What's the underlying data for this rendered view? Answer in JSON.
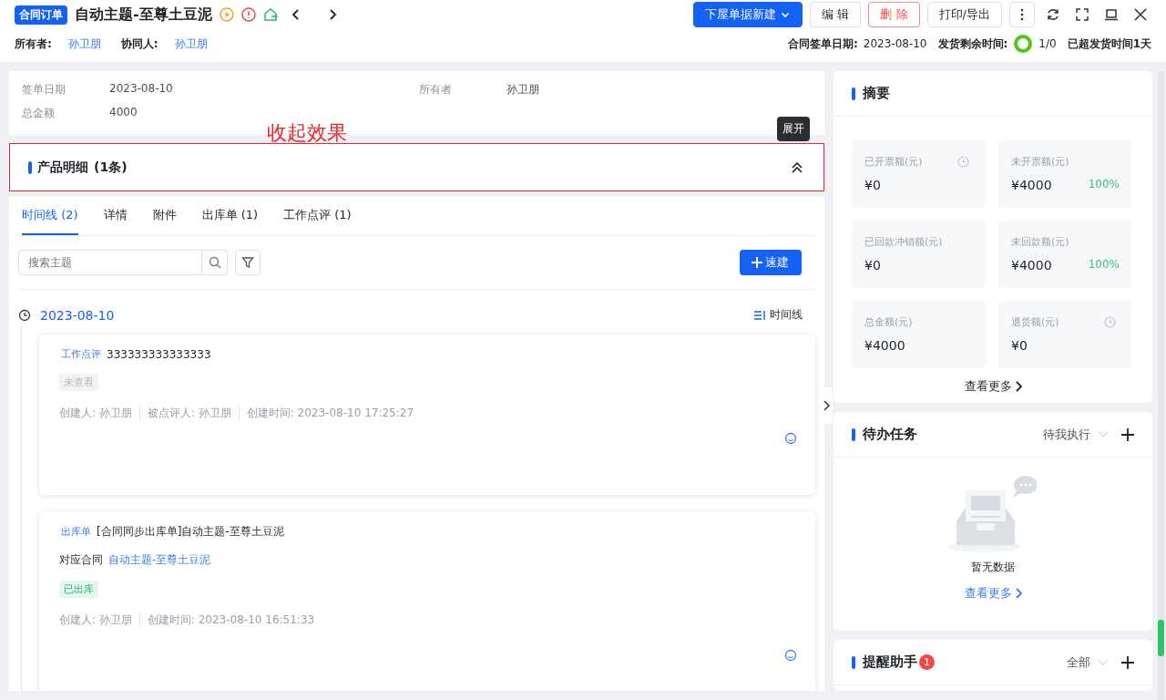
{
  "header": {
    "badge": "合同订单",
    "title": "自动主题-至尊土豆泥",
    "buttons": [
      {
        "label": "下屋单据新建",
        "kind": "primary"
      },
      {
        "label": "编 辑",
        "kind": "default"
      },
      {
        "label": "删 除",
        "kind": "danger"
      },
      {
        "label": "打印/导出",
        "kind": "default"
      }
    ],
    "owner": {
      "label": "所有者:",
      "value": "孙卫朋"
    },
    "collaborator": {
      "label": "协同人:",
      "value": "孙卫朋"
    },
    "sign_date": {
      "label": "合同签单日期:",
      "value": "2023-08-10"
    },
    "ship": {
      "label": "发货剩余时间:",
      "ratio": "1/0",
      "note": "已超发货时间1天"
    }
  },
  "info": [
    {
      "label": "签单日期",
      "value": "2023-08-10"
    },
    {
      "label": "所有者",
      "value": "孙卫朋"
    },
    {
      "label": "总金额",
      "value": "4000"
    }
  ],
  "annotation": {
    "text": "收起效果",
    "tooltip": "展开"
  },
  "section": {
    "title": "产品明细",
    "count": "(1条)"
  },
  "tabs": [
    {
      "label": "时间线 (2)",
      "selected": true
    },
    {
      "label": "详情",
      "selected": false
    },
    {
      "label": "附件",
      "selected": false
    },
    {
      "label": "出库单 (1)",
      "selected": false
    },
    {
      "label": "工作点评 (1)",
      "selected": false
    }
  ],
  "search": {
    "placeholder": "搜索主题"
  },
  "quick_create": "速建",
  "timeline": {
    "date": "2023-08-10",
    "view": "时间线",
    "entries": [
      {
        "kind": "review",
        "tag": "工作点评",
        "title": "333333333333333",
        "status": {
          "label": "未查看",
          "kind": "grey"
        },
        "meta": [
          "创建人: 孙卫朋",
          "被点评人: 孙卫朋",
          "创建时间: 2023-08-10 17:25:27"
        ]
      },
      {
        "kind": "outbound",
        "tag": "出库单",
        "title": "[合同同步出库单]自动主题-至尊土豆泥",
        "contract_label": "对应合同",
        "contract_link": "自动主题-至尊土豆泥",
        "status": {
          "label": "已出库",
          "kind": "green"
        },
        "meta": [
          "创建人: 孙卫朋",
          "创建时间: 2023-08-10 16:51:33"
        ]
      }
    ]
  },
  "summary": {
    "title": "摘要",
    "metrics": [
      {
        "label": "已开票额(元)",
        "value": "¥0",
        "clock": true
      },
      {
        "label": "未开票额(元)",
        "value": "¥4000",
        "percent": "100%",
        "clock": false
      },
      {
        "label": "已回款冲销额(元)",
        "value": "¥0",
        "clock": false
      },
      {
        "label": "未回款额(元)",
        "value": "¥4000",
        "percent": "100%",
        "clock": false
      },
      {
        "label": "总金额(元)",
        "value": "¥4000",
        "clock": false
      },
      {
        "label": "退货额(元)",
        "value": "¥0",
        "clock": true
      }
    ],
    "more": "查看更多"
  },
  "tasks": {
    "title": "待办任务",
    "filter": "待我执行",
    "empty": "暂无数据",
    "more": "查看更多"
  },
  "reminders": {
    "title": "提醒助手",
    "badge": "1",
    "filter": "全部"
  }
}
